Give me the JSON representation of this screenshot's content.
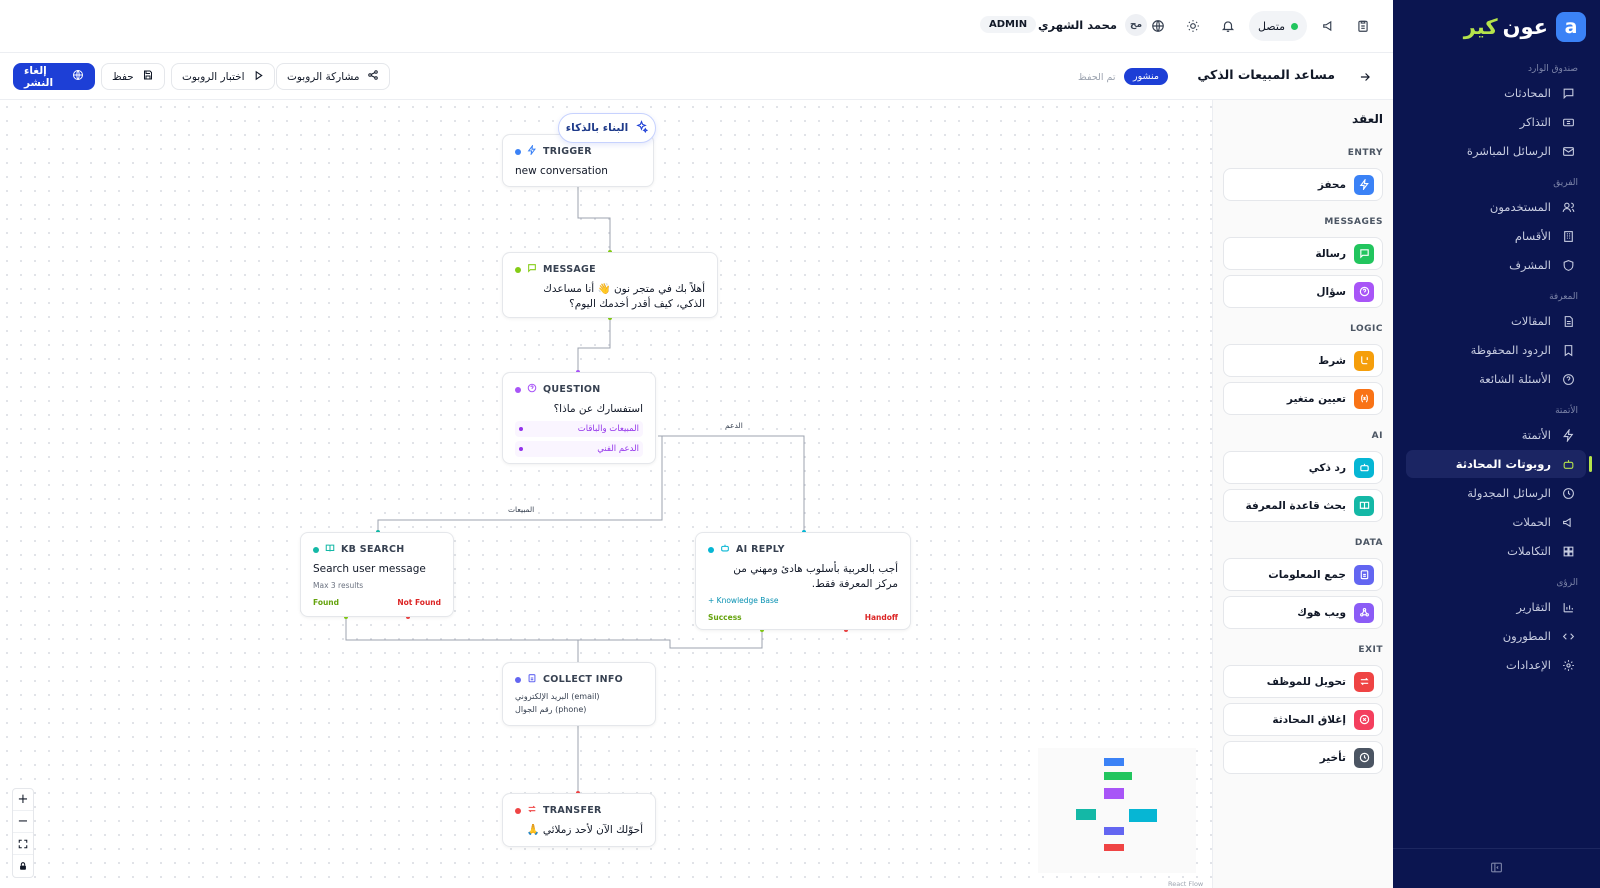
{
  "brand": {
    "part1": "عون",
    "part2": "كير",
    "mark": "a"
  },
  "sidebar": {
    "groups": [
      "صندوق الوارد",
      "الفريق",
      "المعرفة",
      "الأتمتة",
      "الرؤى"
    ],
    "items": [
      {
        "label": "المحادثات",
        "icon": "chat-icon"
      },
      {
        "label": "التذاكر",
        "icon": "ticket-icon"
      },
      {
        "label": "الرسائل المباشرة",
        "icon": "mail-icon"
      },
      {
        "label": "المستخدمون",
        "icon": "users-icon"
      },
      {
        "label": "الأقسام",
        "icon": "building-icon"
      },
      {
        "label": "المشرف",
        "icon": "shield-icon"
      },
      {
        "label": "المقالات",
        "icon": "document-icon"
      },
      {
        "label": "الردود المحفوظة",
        "icon": "bookmark-icon"
      },
      {
        "label": "الأسئلة الشائعة",
        "icon": "help-icon"
      },
      {
        "label": "الأتمتة",
        "icon": "bolt-icon"
      },
      {
        "label": "روبوتات المحادثة",
        "icon": "bot-icon"
      },
      {
        "label": "الرسائل المجدولة",
        "icon": "clock-icon"
      },
      {
        "label": "الحملات",
        "icon": "megaphone-icon"
      },
      {
        "label": "التكاملات",
        "icon": "puzzle-icon"
      },
      {
        "label": "التقارير",
        "icon": "chart-icon"
      },
      {
        "label": "المطورون",
        "icon": "code-icon"
      },
      {
        "label": "الإعدادات",
        "icon": "gear-icon"
      }
    ],
    "active_index": 10
  },
  "topbar": {
    "status": "متصل",
    "user_name": "محمد الشهري",
    "avatar_initials": "مح",
    "role_badge": "ADMIN"
  },
  "subbar": {
    "flow_title": "مساعد المبيعات الذكي",
    "status_pill": "منشور",
    "saved_text": "تم الحفظ",
    "share_label": "مشاركة الروبوت",
    "test_label": "اختبار الروبوت",
    "save_label": "حفظ",
    "unpublish_label": "إلغاء النشر"
  },
  "canvas": {
    "ai_build_label": "البناء بالذكاء",
    "nodes": {
      "trigger": {
        "type": "TRIGGER",
        "text": "new conversation",
        "color": "#3b82f6"
      },
      "message": {
        "type": "MESSAGE",
        "text": "أهلاً بك في متجر نون 👋 أنا مساعدك الذكي، كيف أقدر أخدمك اليوم؟",
        "color": "#84cc16"
      },
      "question": {
        "type": "QUESTION",
        "text": "استفسارك عن ماذا؟",
        "options": [
          "المبيعات والباقات",
          "الدعم الفني"
        ],
        "color": "#a855f7"
      },
      "kb": {
        "type": "KB SEARCH",
        "text": "Search user message",
        "sub": "Max 3 results",
        "out_ok": "Found",
        "out_fail": "Not Found",
        "color": "#14b8a6"
      },
      "ai": {
        "type": "AI REPLY",
        "text": "أجب بالعربية بأسلوب هادئ ومهني من مركز المعرفة فقط.",
        "sub": "+ Knowledge Base",
        "out_ok": "Success",
        "out_fail": "Handoff",
        "color": "#06b6d4"
      },
      "collect": {
        "type": "COLLECT INFO",
        "fields": [
          "البريد الإلكتروني (email)",
          "رقم الجوال (phone)"
        ],
        "color": "#6366f1"
      },
      "transfer": {
        "type": "TRANSFER",
        "text": "أحوّلك الآن لأحد زملائي 🙏",
        "color": "#ef4444"
      }
    },
    "edge_labels": {
      "support": "الدعم",
      "sales": "المبيعات"
    },
    "attribution": "React Flow"
  },
  "palette": {
    "title": "العقد",
    "sections": [
      {
        "name": "ENTRY",
        "items": [
          {
            "label": "محفز",
            "color": "#3b82f6",
            "icon": "bolt-icon"
          }
        ]
      },
      {
        "name": "MESSAGES",
        "items": [
          {
            "label": "رسالة",
            "color": "#22c55e",
            "icon": "chat-icon"
          },
          {
            "label": "سؤال",
            "color": "#a855f7",
            "icon": "help-icon"
          }
        ]
      },
      {
        "name": "LOGIC",
        "items": [
          {
            "label": "شرط",
            "color": "#f59e0b",
            "icon": "branch-icon"
          },
          {
            "label": "تعيين متغير",
            "color": "#f97316",
            "icon": "variable-icon"
          }
        ]
      },
      {
        "name": "AI",
        "items": [
          {
            "label": "رد ذكي",
            "color": "#06b6d4",
            "icon": "bot-icon"
          },
          {
            "label": "بحث قاعدة المعرفة",
            "color": "#14b8a6",
            "icon": "book-icon"
          }
        ]
      },
      {
        "name": "DATA",
        "items": [
          {
            "label": "جمع المعلومات",
            "color": "#6366f1",
            "icon": "clipboard-icon"
          },
          {
            "label": "ويب هوك",
            "color": "#8b5cf6",
            "icon": "webhook-icon"
          }
        ]
      },
      {
        "name": "EXIT",
        "items": [
          {
            "label": "تحويل للموظف",
            "color": "#ef4444",
            "icon": "transfer-icon"
          },
          {
            "label": "إغلاق المحادثة",
            "color": "#f43f5e",
            "icon": "close-icon"
          },
          {
            "label": "تأخير",
            "color": "#4b5563",
            "icon": "clock-icon"
          }
        ]
      }
    ]
  }
}
